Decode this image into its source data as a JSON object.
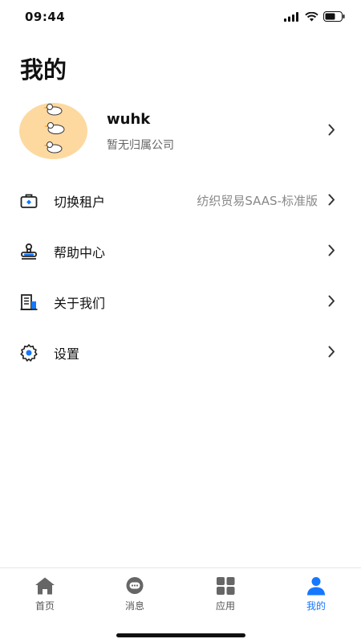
{
  "status": {
    "time": "09:44"
  },
  "page": {
    "title": "我的"
  },
  "profile": {
    "name": "wuhk",
    "company": "暂无归属公司"
  },
  "menu": [
    {
      "label": "切换租户",
      "value": "纺织贸易SAAS-标准版",
      "icon": "tenant-switch-icon"
    },
    {
      "label": "帮助中心",
      "icon": "help-stamp-icon"
    },
    {
      "label": "关于我们",
      "icon": "building-icon"
    },
    {
      "label": "设置",
      "icon": "gear-icon"
    }
  ],
  "tabs": [
    {
      "label": "首页",
      "icon": "home-icon",
      "active": false
    },
    {
      "label": "消息",
      "icon": "message-icon",
      "active": false
    },
    {
      "label": "应用",
      "icon": "apps-grid-icon",
      "active": false
    },
    {
      "label": "我的",
      "icon": "person-icon",
      "active": true
    }
  ],
  "colors": {
    "accent": "#1677ff",
    "icon_gray": "#666666",
    "avatar_bg": "#fdd9a0"
  }
}
